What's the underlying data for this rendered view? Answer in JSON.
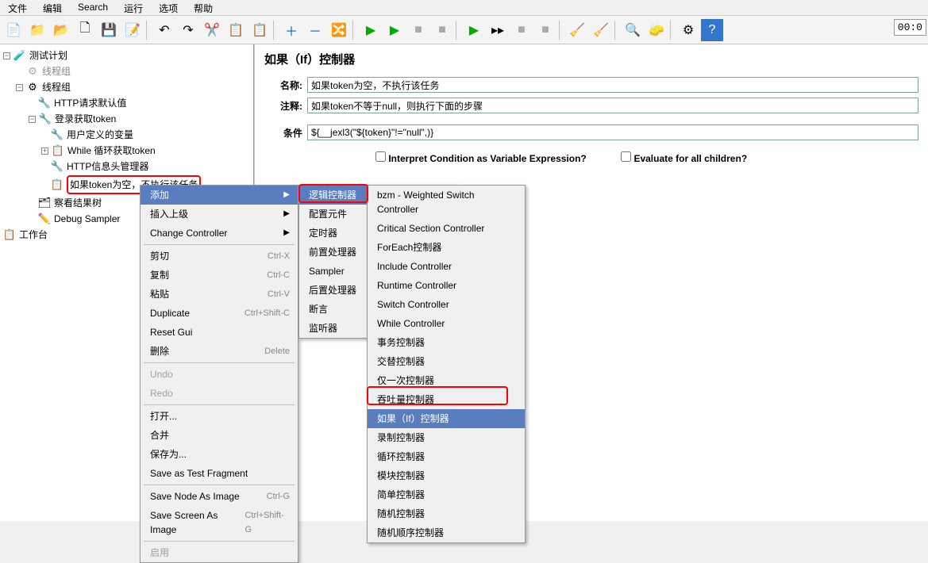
{
  "menu": {
    "file": "文件",
    "edit": "编辑",
    "search": "Search",
    "run": "运行",
    "options": "选项",
    "help": "帮助"
  },
  "timer": "00:0",
  "tree": {
    "root": "测试计划",
    "threadGroup1": "线程组",
    "threadGroup2": "线程组",
    "httpDefaults": "HTTP请求默认值",
    "loginToken": "登录获取token",
    "userVars": "用户定义的变量",
    "whileLoop": "While 循环获取token",
    "httpHeader": "HTTP信息头管理器",
    "ifEmpty": "如果token为空，不执行该任务",
    "resultTree": "察看结果树",
    "debug": "Debug Sampler",
    "workbench": "工作台"
  },
  "panel": {
    "title": "如果（If）控制器",
    "nameLabel": "名称:",
    "nameValue": "如果token为空，不执行该任务",
    "commentLabel": "注释:",
    "commentValue": "如果token不等于null，则执行下面的步骤",
    "condLabel": "条件",
    "condValue": "${__jexl3(\"${token}\"!=\"null\",)}",
    "interpret": "Interpret Condition as Variable Expression?",
    "evalAll": "Evaluate for all children?"
  },
  "ctx1": {
    "add": "添加",
    "insertParent": "插入上级",
    "changeCtrl": "Change Controller",
    "cut": "剪切",
    "copy": "复制",
    "paste": "粘贴",
    "duplicate": "Duplicate",
    "resetGui": "Reset Gui",
    "delete": "删除",
    "undo": "Undo",
    "redo": "Redo",
    "open": "打开...",
    "merge": "合并",
    "saveAs": "保存为...",
    "saveFrag": "Save as Test Fragment",
    "saveNode": "Save Node As Image",
    "saveScreen": "Save Screen As Image",
    "enable": "启用",
    "scCut": "Ctrl-X",
    "scCopy": "Ctrl-C",
    "scPaste": "Ctrl-V",
    "scDup": "Ctrl+Shift-C",
    "scDel": "Delete",
    "scNode": "Ctrl-G",
    "scScreen": "Ctrl+Shift-G"
  },
  "ctx2": {
    "logic": "逻辑控制器",
    "config": "配置元件",
    "timer": "定时器",
    "pre": "前置处理器",
    "sampler": "Sampler",
    "post": "后置处理器",
    "assert": "断言",
    "listener": "监听器"
  },
  "ctx3": {
    "i0": "bzm - Weighted Switch Controller",
    "i1": "Critical Section Controller",
    "i2": "ForEach控制器",
    "i3": "Include Controller",
    "i4": "Runtime Controller",
    "i5": "Switch Controller",
    "i6": "While Controller",
    "i7": "事务控制器",
    "i8": "交替控制器",
    "i9": "仅一次控制器",
    "i10": "吞吐量控制器",
    "i11": "如果（If）控制器",
    "i12": "录制控制器",
    "i13": "循环控制器",
    "i14": "模块控制器",
    "i15": "简单控制器",
    "i16": "随机控制器",
    "i17": "随机顺序控制器"
  }
}
